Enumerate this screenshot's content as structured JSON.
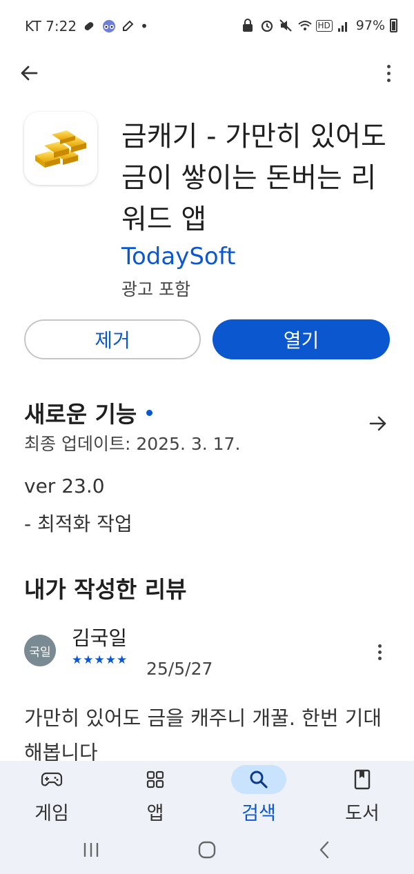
{
  "status_bar": {
    "carrier_time": "KT 7:22",
    "dot": "•",
    "battery": "97%",
    "hd_label": "HD"
  },
  "app": {
    "title": "금캐기 - 가만히 있어도 금이 쌓이는 돈버는 리워드 앱",
    "developer": "TodaySoft",
    "ads_note": "광고 포함",
    "icon": "gold-bars-icon"
  },
  "actions": {
    "uninstall_label": "제거",
    "open_label": "열기"
  },
  "whats_new": {
    "title": "새로운 기능",
    "last_updated": "최종 업데이트: 2025. 3. 17.",
    "version": "ver 23.0",
    "changelog": "- 최적화 작업"
  },
  "my_review": {
    "section_title": "내가 작성한 리뷰",
    "avatar_text": "국일",
    "reviewer": "김국일",
    "stars": "★★★★★",
    "rating": 5,
    "date": "25/5/27",
    "text": "가만히 있어도 금을 캐주니 개꿀. 한번 기대해봅니다"
  },
  "bottom_nav": {
    "items": [
      {
        "label": "게임",
        "icon": "gamepad-icon",
        "active": false
      },
      {
        "label": "앱",
        "icon": "apps-grid-icon",
        "active": false
      },
      {
        "label": "검색",
        "icon": "search-icon",
        "active": true
      },
      {
        "label": "도서",
        "icon": "book-icon",
        "active": false
      }
    ]
  },
  "colors": {
    "accent": "#0b57d0",
    "active_nav_bg": "#c9e3ff",
    "nav_bg": "#eef2f8"
  }
}
